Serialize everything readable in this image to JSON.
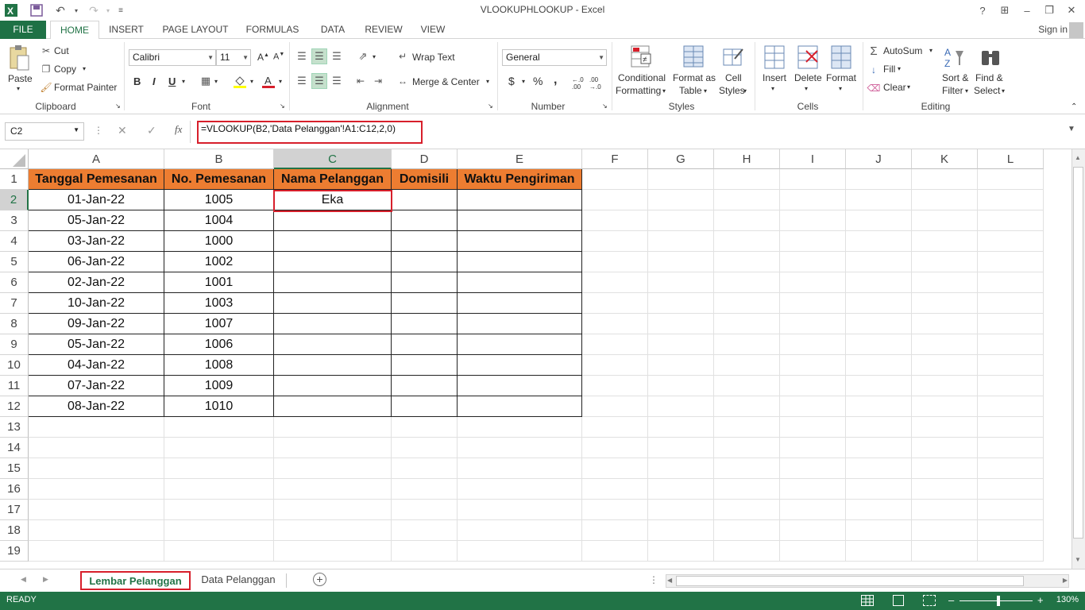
{
  "window": {
    "title": "VLOOKUPHLOOKUP - Excel",
    "help": "?",
    "signin": "Sign in"
  },
  "tabs": [
    "FILE",
    "HOME",
    "INSERT",
    "PAGE LAYOUT",
    "FORMULAS",
    "DATA",
    "REVIEW",
    "VIEW"
  ],
  "ribbon": {
    "clipboard": {
      "label": "Clipboard",
      "paste": "Paste",
      "cut": "Cut",
      "copy": "Copy",
      "format_painter": "Format Painter"
    },
    "font": {
      "label": "Font",
      "font_name": "Calibri",
      "font_size": "11",
      "bold": "B",
      "italic": "I",
      "underline": "U"
    },
    "alignment": {
      "label": "Alignment",
      "wrap_text": "Wrap Text",
      "merge_center": "Merge & Center"
    },
    "number": {
      "label": "Number",
      "format": "General",
      "currency": "$",
      "percent": "%",
      "comma": ","
    },
    "styles": {
      "label": "Styles",
      "conditional": "Conditional",
      "formatting": "Formatting",
      "format_as": "Format as",
      "table": "Table",
      "cell": "Cell",
      "cell_styles": "Styles"
    },
    "cells": {
      "label": "Cells",
      "insert": "Insert",
      "delete": "Delete",
      "format": "Format"
    },
    "editing": {
      "label": "Editing",
      "autosum": "AutoSum",
      "fill": "Fill",
      "clear": "Clear",
      "sort": "Sort &",
      "filter": "Filter",
      "find": "Find &",
      "select": "Select"
    }
  },
  "formula_bar": {
    "name_box": "C2",
    "fx": "fx",
    "formula": "=VLOOKUP(B2,'Data Pelanggan'!A1:C12,2,0)"
  },
  "sheet": {
    "columns": [
      "A",
      "B",
      "C",
      "D",
      "E",
      "F",
      "G",
      "H",
      "I",
      "J",
      "K",
      "L"
    ],
    "rows": [
      "1",
      "2",
      "3",
      "4",
      "5",
      "6",
      "7",
      "8",
      "9",
      "10",
      "11",
      "12",
      "13",
      "14",
      "15",
      "16",
      "17",
      "18",
      "19"
    ],
    "headers": [
      "Tanggal Pemesanan",
      "No. Pemesanan",
      "Nama Pelanggan",
      "Domisili",
      "Waktu Pengiriman"
    ],
    "data": [
      [
        "01-Jan-22",
        "1005",
        "Eka",
        "",
        ""
      ],
      [
        "05-Jan-22",
        "1004",
        "",
        "",
        ""
      ],
      [
        "03-Jan-22",
        "1000",
        "",
        "",
        ""
      ],
      [
        "06-Jan-22",
        "1002",
        "",
        "",
        ""
      ],
      [
        "02-Jan-22",
        "1001",
        "",
        "",
        ""
      ],
      [
        "10-Jan-22",
        "1003",
        "",
        "",
        ""
      ],
      [
        "09-Jan-22",
        "1007",
        "",
        "",
        ""
      ],
      [
        "05-Jan-22",
        "1006",
        "",
        "",
        ""
      ],
      [
        "04-Jan-22",
        "1008",
        "",
        "",
        ""
      ],
      [
        "07-Jan-22",
        "1009",
        "",
        "",
        ""
      ],
      [
        "08-Jan-22",
        "1010",
        "",
        "",
        ""
      ]
    ],
    "active_cell": "C2",
    "header_fill": "#ed7d31"
  },
  "sheet_tabs": [
    "Lembar Pelanggan",
    "Data Pelanggan"
  ],
  "status": {
    "ready": "READY",
    "zoom": "130%"
  },
  "colors": {
    "accent": "#217346",
    "highlight": "#d71f2b"
  }
}
